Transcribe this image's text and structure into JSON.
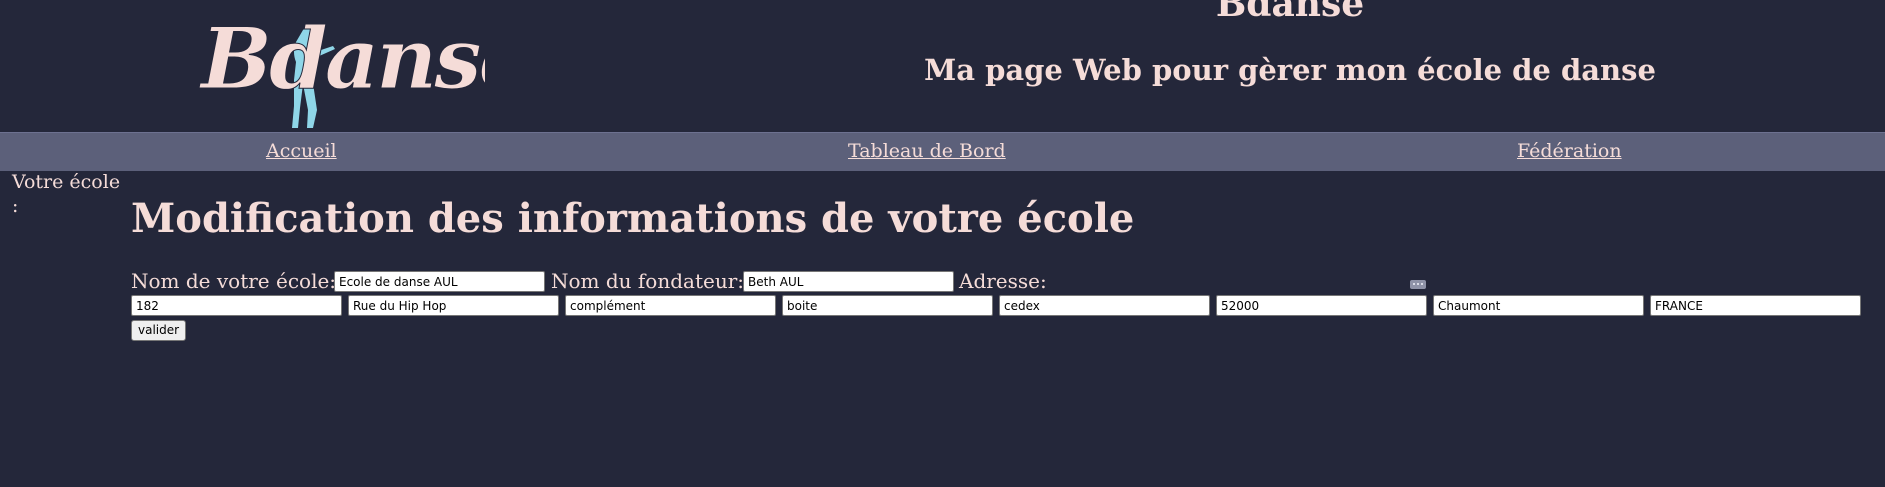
{
  "header": {
    "logo_text": "Bdanse",
    "title": "Bdanse",
    "subtitle": "Ma page Web pour gèrer mon école de danse"
  },
  "nav": {
    "items": [
      "Accueil",
      "Tableau de Bord",
      "Fédération"
    ]
  },
  "sidebar": {
    "label": "Votre école :"
  },
  "main": {
    "title": "Modification des informations de votre école",
    "labels": {
      "school_name": "Nom de votre école:",
      "founder": "Nom du fondateur:",
      "address": "Adresse:"
    },
    "fields": {
      "school_name": "Ecole de danse AUL",
      "founder": "Beth AUL",
      "street_number": "182",
      "street": "Rue du Hip Hop",
      "complement": "complément",
      "box": "boite",
      "cedex": "cedex",
      "postal_code": "52000",
      "city": "Chaumont",
      "country": "FRANCE"
    },
    "submit_label": "valider"
  },
  "colors": {
    "background": "#24273a",
    "nav_background": "#5c607a",
    "text": "#f5dcd8",
    "logo_figure": "#8fd6e8"
  }
}
